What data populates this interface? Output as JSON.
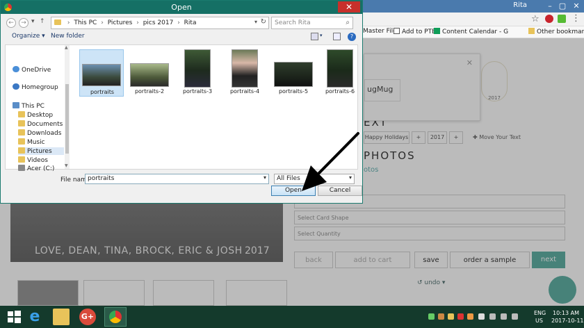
{
  "dialog": {
    "title": "Open",
    "close_glyph": "✕",
    "path": [
      "This PC",
      "Pictures",
      "pics 2017",
      "Rita"
    ],
    "search_placeholder": "Search Rita",
    "organize_label": "Organize ▾",
    "new_folder_label": "New folder",
    "help_glyph": "?",
    "nav_items": [
      {
        "label": "OneDrive",
        "icon": "onedrive-icon"
      },
      {
        "label": "Homegroup",
        "icon": "homegroup-icon"
      },
      {
        "label": "This PC",
        "icon": "computer-icon"
      },
      {
        "label": "Desktop",
        "icon": "folder-icon"
      },
      {
        "label": "Documents",
        "icon": "folder-icon"
      },
      {
        "label": "Downloads",
        "icon": "folder-icon"
      },
      {
        "label": "Music",
        "icon": "folder-icon"
      },
      {
        "label": "Pictures",
        "icon": "folder-icon",
        "selected": true
      },
      {
        "label": "Videos",
        "icon": "folder-icon"
      },
      {
        "label": "Acer (C:)",
        "icon": "drive-icon"
      }
    ],
    "files": [
      {
        "name": "portraits",
        "selected": true
      },
      {
        "name": "portraits-2"
      },
      {
        "name": "portraits-3"
      },
      {
        "name": "portraits-4"
      },
      {
        "name": "portraits-5"
      },
      {
        "name": "portraits-6"
      }
    ],
    "file_name_label": "File name:",
    "file_name_value": "portraits",
    "file_type_value": "All Files",
    "open_label": "Open",
    "cancel_label": "Cancel"
  },
  "browser": {
    "user_badge": "Rita",
    "bookmarks": [
      "Master File",
      "Add to PTE",
      "Content Calendar - G",
      "Other bookmarks"
    ]
  },
  "page": {
    "modal_brand": "ugMug",
    "circle_year": "2017",
    "heading_text": "EXT",
    "chip_holiday": "Happy Holidays",
    "chip_plus": "+",
    "chip_year": "2017",
    "move_text": "✚ Move Your Text",
    "heading_photos": "PHOTOS",
    "link_photos": "otos",
    "select_shape": "Select Card Shape",
    "select_quantity": "Select Quantity",
    "btn_back": "back",
    "btn_add_to_cart": "add to cart",
    "btn_save": "save",
    "btn_sample": "order a sample",
    "btn_next": "next",
    "undo": "↺ undo ▾",
    "photo_caption": "LOVE, DEAN, TINA, BROCK, ERIC & JOSH",
    "photo_year": "2017"
  },
  "taskbar": {
    "lang_top": "ENG",
    "lang_bottom": "US",
    "time": "10:13 AM",
    "date": "2017-10-11"
  },
  "colors": {
    "dialog_title_bar": "#157065",
    "taskbar": "#143a2c",
    "accent_teal": "#4da89a"
  }
}
